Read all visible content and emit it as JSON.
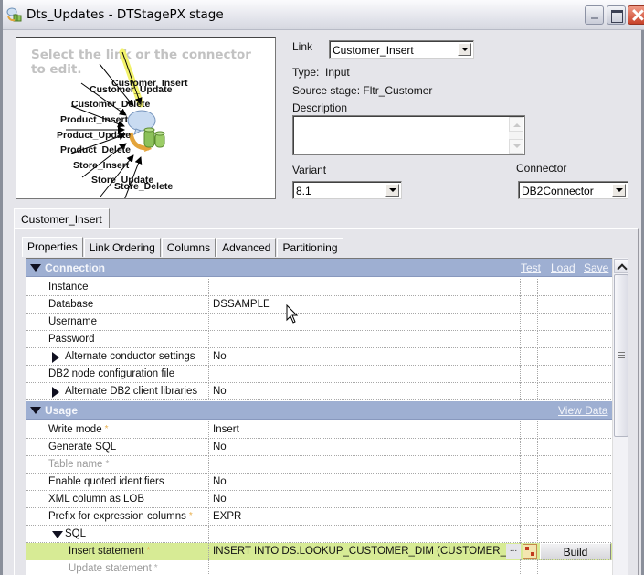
{
  "window": {
    "title": "Dts_Updates - DTStagePX stage",
    "icons": {
      "app": "stage-app-icon",
      "minimize": "minimize-icon",
      "maximize": "maximize-icon",
      "close": "close-icon"
    }
  },
  "preview": {
    "hint": "Select the link or the connector to edit.",
    "center_icon": "db2-connector-icon",
    "selected_link": "Customer_Insert",
    "highlight_color": "#f2f26a",
    "links": [
      "Customer_Insert",
      "Customer_Update",
      "Customer_Delete",
      "Product_Insert",
      "Product_Update",
      "Product_Delete",
      "Store_Insert",
      "Store_Update",
      "Store_Delete"
    ]
  },
  "fields": {
    "link_label": "Link",
    "link_value": "Customer_Insert",
    "type_label": "Type:",
    "type_value": "Input",
    "source_label": "Source stage:",
    "source_value": "Fltr_Customer",
    "description_label": "Description",
    "description_value": "",
    "variant_label": "Variant",
    "variant_value": "8.1",
    "connector_label": "Connector",
    "connector_value": "DB2Connector"
  },
  "outer_tab": {
    "label": "Customer_Insert"
  },
  "tabs": [
    {
      "label": "Properties",
      "active": true
    },
    {
      "label": "Link Ordering",
      "active": false
    },
    {
      "label": "Columns",
      "active": false
    },
    {
      "label": "Advanced",
      "active": false
    },
    {
      "label": "Partitioning",
      "active": false
    }
  ],
  "grid": {
    "header_color": "#9eafd2",
    "highlight_color": "#d7eb95",
    "sections": [
      {
        "title": "Connection",
        "links": [
          "Test",
          "Load",
          "Save"
        ],
        "rows": [
          {
            "name": "Instance",
            "value": "",
            "level": 0
          },
          {
            "name": "Database",
            "value": "DSSAMPLE",
            "level": 0
          },
          {
            "name": "Username",
            "value": "",
            "level": 0
          },
          {
            "name": "Password",
            "value": "",
            "level": 0
          },
          {
            "name": "Alternate conductor settings",
            "value": "No",
            "level": 0,
            "expander": "collapsed"
          },
          {
            "name": "DB2 node configuration file",
            "value": "",
            "level": 0
          },
          {
            "name": "Alternate DB2 client libraries",
            "value": "No",
            "level": 0,
            "expander": "collapsed"
          }
        ]
      },
      {
        "title": "Usage",
        "links": [
          "View Data"
        ],
        "rows": [
          {
            "name": "Write mode",
            "value": "Insert",
            "required": true
          },
          {
            "name": "Generate SQL",
            "value": "No"
          },
          {
            "name": "Table name",
            "value": "",
            "required": true,
            "disabled": true
          },
          {
            "name": "Enable quoted identifiers",
            "value": "No"
          },
          {
            "name": "XML column as LOB",
            "value": "No"
          },
          {
            "name": "Prefix for expression columns",
            "value": "EXPR",
            "required": true
          },
          {
            "name": "SQL",
            "value": "",
            "expander": "expanded"
          },
          {
            "name": "Insert statement",
            "value": "INSERT INTO DS.LOOKUP_CUSTOMER_DIM (CUSTOMER_I...",
            "required": true,
            "selected": true,
            "ellipsis": "...",
            "build_label": "Build"
          },
          {
            "name": "Update statement",
            "value": "",
            "required": true,
            "disabled": true
          }
        ]
      }
    ],
    "required_marker": "*"
  }
}
